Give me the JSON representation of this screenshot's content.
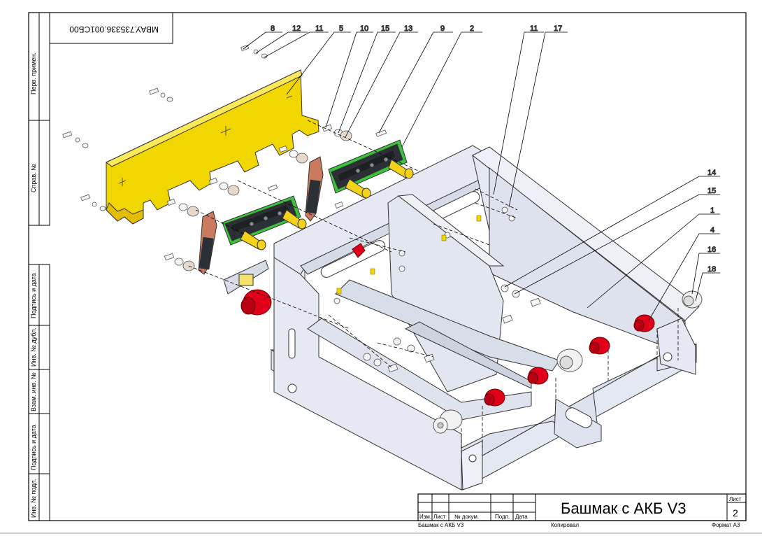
{
  "drawing_code": "МВАУ.735336.001СБ00",
  "title": "Башмак с АКБ V3",
  "sheet_label": "Лист",
  "sheet_number": "2",
  "left_strip": {
    "perv_primen": "Перв. примен.",
    "sprav_no": "Справ. №",
    "podpis_data_1": "Подпись и дата",
    "inv_dubl": "Инв. № дубл.",
    "vzam_inv": "Взам. инв. №",
    "podpis_data_2": "Подпись и дата",
    "inv_podl": "Инв. № подл."
  },
  "title_block": {
    "izm": "Изм.",
    "list": "Лист",
    "doc_no": "№ докум.",
    "podp": "Подп.",
    "data": "Дата",
    "footer_name": "Башмак с АКБ V3",
    "kopiroval": "Копировал",
    "format": "Формат А3"
  },
  "callouts": [
    "8",
    "12",
    "11",
    "5",
    "10",
    "15",
    "13",
    "9",
    "2",
    "11",
    "17",
    "14",
    "15",
    "1",
    "4",
    "16",
    "18"
  ],
  "colors": {
    "frame": "#e4e8f2",
    "bracket": "#f2d600",
    "terminal_red": "#e0001a",
    "battery_body": "#2b2f36",
    "battery_edge": "#3cc23c",
    "copper": "#c97a5f",
    "post": "#f3d21a"
  }
}
